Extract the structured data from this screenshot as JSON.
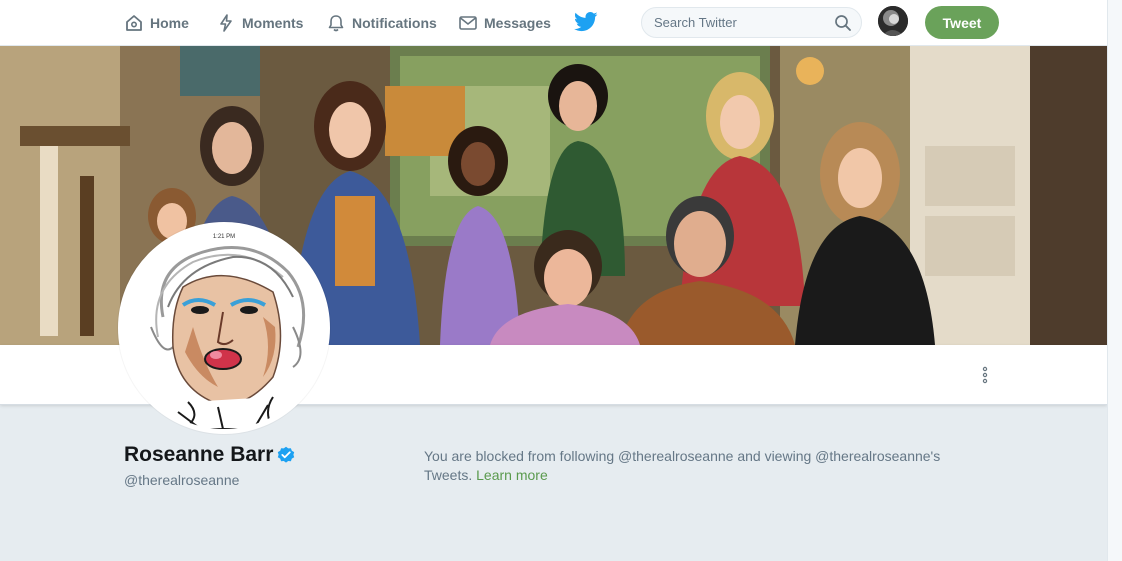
{
  "nav": {
    "home": "Home",
    "moments": "Moments",
    "notifications": "Notifications",
    "messages": "Messages",
    "icons": [
      "home-icon",
      "moments-icon",
      "notifications-icon",
      "messages-icon",
      "twitter-bird-icon"
    ]
  },
  "search": {
    "placeholder": "Search Twitter",
    "value": ""
  },
  "tweet_button": "Tweet",
  "profile": {
    "name": "Roseanne Barr",
    "handle": "@therealroseanne",
    "verified": true,
    "avatar_caption": "1:21 PM"
  },
  "blocked": {
    "message": "You are blocked from following @therealroseanne and viewing @therealroseanne's Tweets.",
    "learn_more": "Learn more"
  },
  "colors": {
    "accent": "#6aa25a",
    "link": "#5a9a4d",
    "verified": "#1da1f2",
    "background": "#e6ecf0"
  }
}
